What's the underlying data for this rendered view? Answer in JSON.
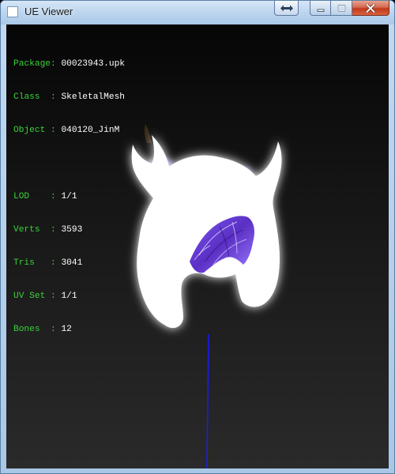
{
  "window": {
    "title": "UE Viewer"
  },
  "info": {
    "package_key": "Package:",
    "package_value": "00023943.upk",
    "class_key": "Class  :",
    "class_value": "SkeletalMesh",
    "object_key": "Object :",
    "object_value": "040120_JinM",
    "lod_key": "LOD    :",
    "lod_value": "1/1",
    "verts_key": "Verts  :",
    "verts_value": "3593",
    "tris_key": "Tris   :",
    "tris_value": "3041",
    "uvset_key": "UV Set :",
    "uvset_value": "1/1",
    "bones_key": "Bones  :",
    "bones_value": "12"
  },
  "colors": {
    "label_green": "#39d339",
    "value_white": "#ffffff",
    "hair_purple": "#6a3fd0",
    "axis_blue": "#1a1aff"
  },
  "icons": {
    "app": "app-window-icon",
    "restore_alt": "double-arrow-icon",
    "minimize": "minimize-icon",
    "maximize": "maximize-icon",
    "close": "close-icon"
  }
}
